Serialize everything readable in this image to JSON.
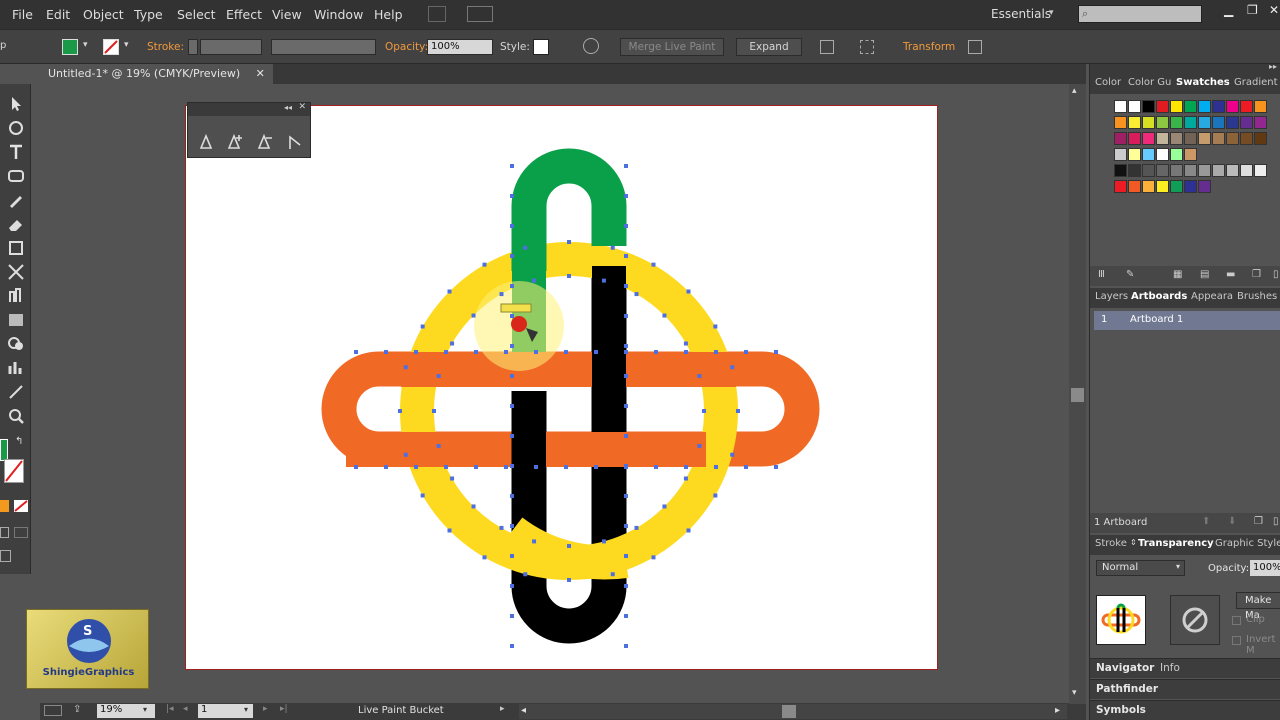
{
  "menu": [
    "File",
    "Edit",
    "Object",
    "Type",
    "Select",
    "Effect",
    "View",
    "Window",
    "Help"
  ],
  "workspace": "Essentials",
  "control": {
    "stroke_label": "Stroke:",
    "opacity_label": "Opacity:",
    "opacity_value": "100%",
    "style_label": "Style:",
    "merge_live_paint": "Merge Live Paint",
    "expand": "Expand",
    "transform": "Transform",
    "fill_color": "#1a9a48"
  },
  "document_tab": "Untitled-1* @ 19% (CMYK/Preview)",
  "status": {
    "zoom": "19%",
    "page": "1",
    "tool": "Live Paint Bucket"
  },
  "logo_text": "ShingieGraphics",
  "panels": {
    "color_tabs": [
      "Color",
      "Color Gu",
      "Swatches",
      "Gradient"
    ],
    "layer_tabs": [
      "Layers",
      "Artboards",
      "Appeara",
      "Brushes"
    ],
    "artboard_item": {
      "index": "1",
      "name": "Artboard 1"
    },
    "artboard_count": "1 Artboard",
    "transparency_tabs": [
      "Stroke",
      "Transparency",
      "Graphic Style"
    ],
    "blend_mode": "Normal",
    "opacity_label": "Opacity:",
    "opacity_value": "100%",
    "make_mask": "Make Ma",
    "clip": "Clip",
    "invert": "Invert M",
    "navigator_tabs": [
      "Navigator",
      "Info"
    ],
    "pathfinder": "Pathfinder",
    "symbols": "Symbols"
  },
  "colors": {
    "green": "#0aa04a",
    "yellow": "#fdda20",
    "orange": "#f06a25",
    "black": "#000000",
    "anchor": "#4d6fe0"
  }
}
